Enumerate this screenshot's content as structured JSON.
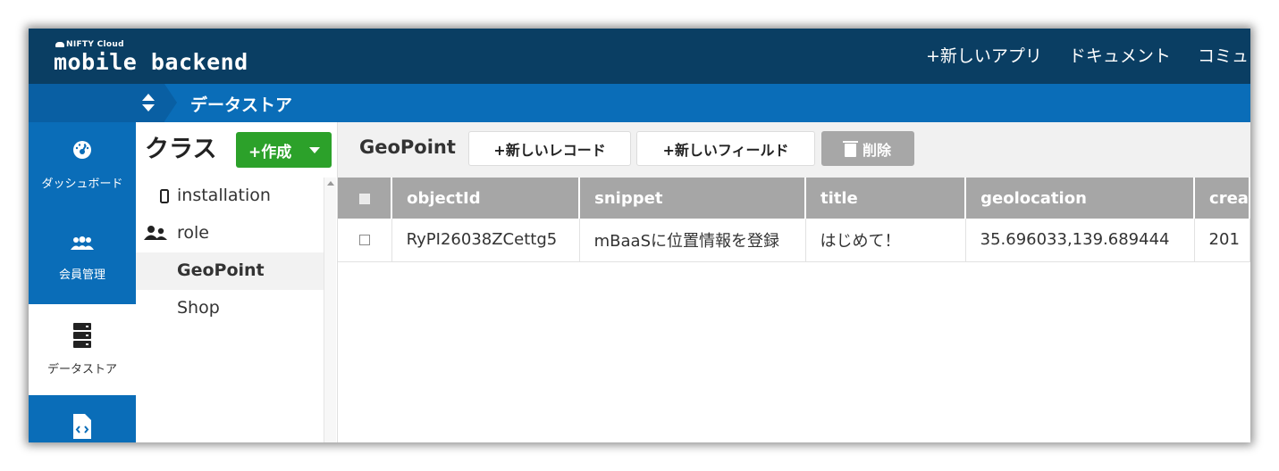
{
  "header": {
    "brand_small": "NIFTY Cloud",
    "brand_big": "mobile backend",
    "nav": [
      "+新しいアプリ",
      "ドキュメント",
      "コミュ"
    ]
  },
  "breadcrumb": {
    "title": "データストア"
  },
  "leftnav": {
    "items": [
      {
        "label": "ダッシュボード",
        "icon": "gauge-icon"
      },
      {
        "label": "会員管理",
        "icon": "users-icon"
      },
      {
        "label": "データストア",
        "icon": "database-icon",
        "active": true
      },
      {
        "label": "",
        "icon": "script-file-icon"
      }
    ]
  },
  "classes": {
    "title": "クラス",
    "create_label": "+作成",
    "items": [
      {
        "label": "installation",
        "icon": "phone-icon"
      },
      {
        "label": "role",
        "icon": "role-users-icon"
      },
      {
        "label": "GeoPoint",
        "selected": true
      },
      {
        "label": "Shop"
      }
    ]
  },
  "main": {
    "current_class": "GeoPoint",
    "new_record_label": "+新しいレコード",
    "new_field_label": "+新しいフィールド",
    "delete_label": "削除"
  },
  "table": {
    "columns": [
      "objectId",
      "snippet",
      "title",
      "geolocation",
      "crea"
    ],
    "rows": [
      [
        "RyPI26038ZCettg5",
        "mBaaSに位置情報を登録",
        "はじめて！",
        "35.696033,139.689444",
        "201"
      ]
    ]
  },
  "colors": {
    "header_bg": "#0a3e63",
    "accent_blue": "#0a6db8",
    "create_green": "#2ca12a",
    "table_header": "#a6a6a6"
  }
}
